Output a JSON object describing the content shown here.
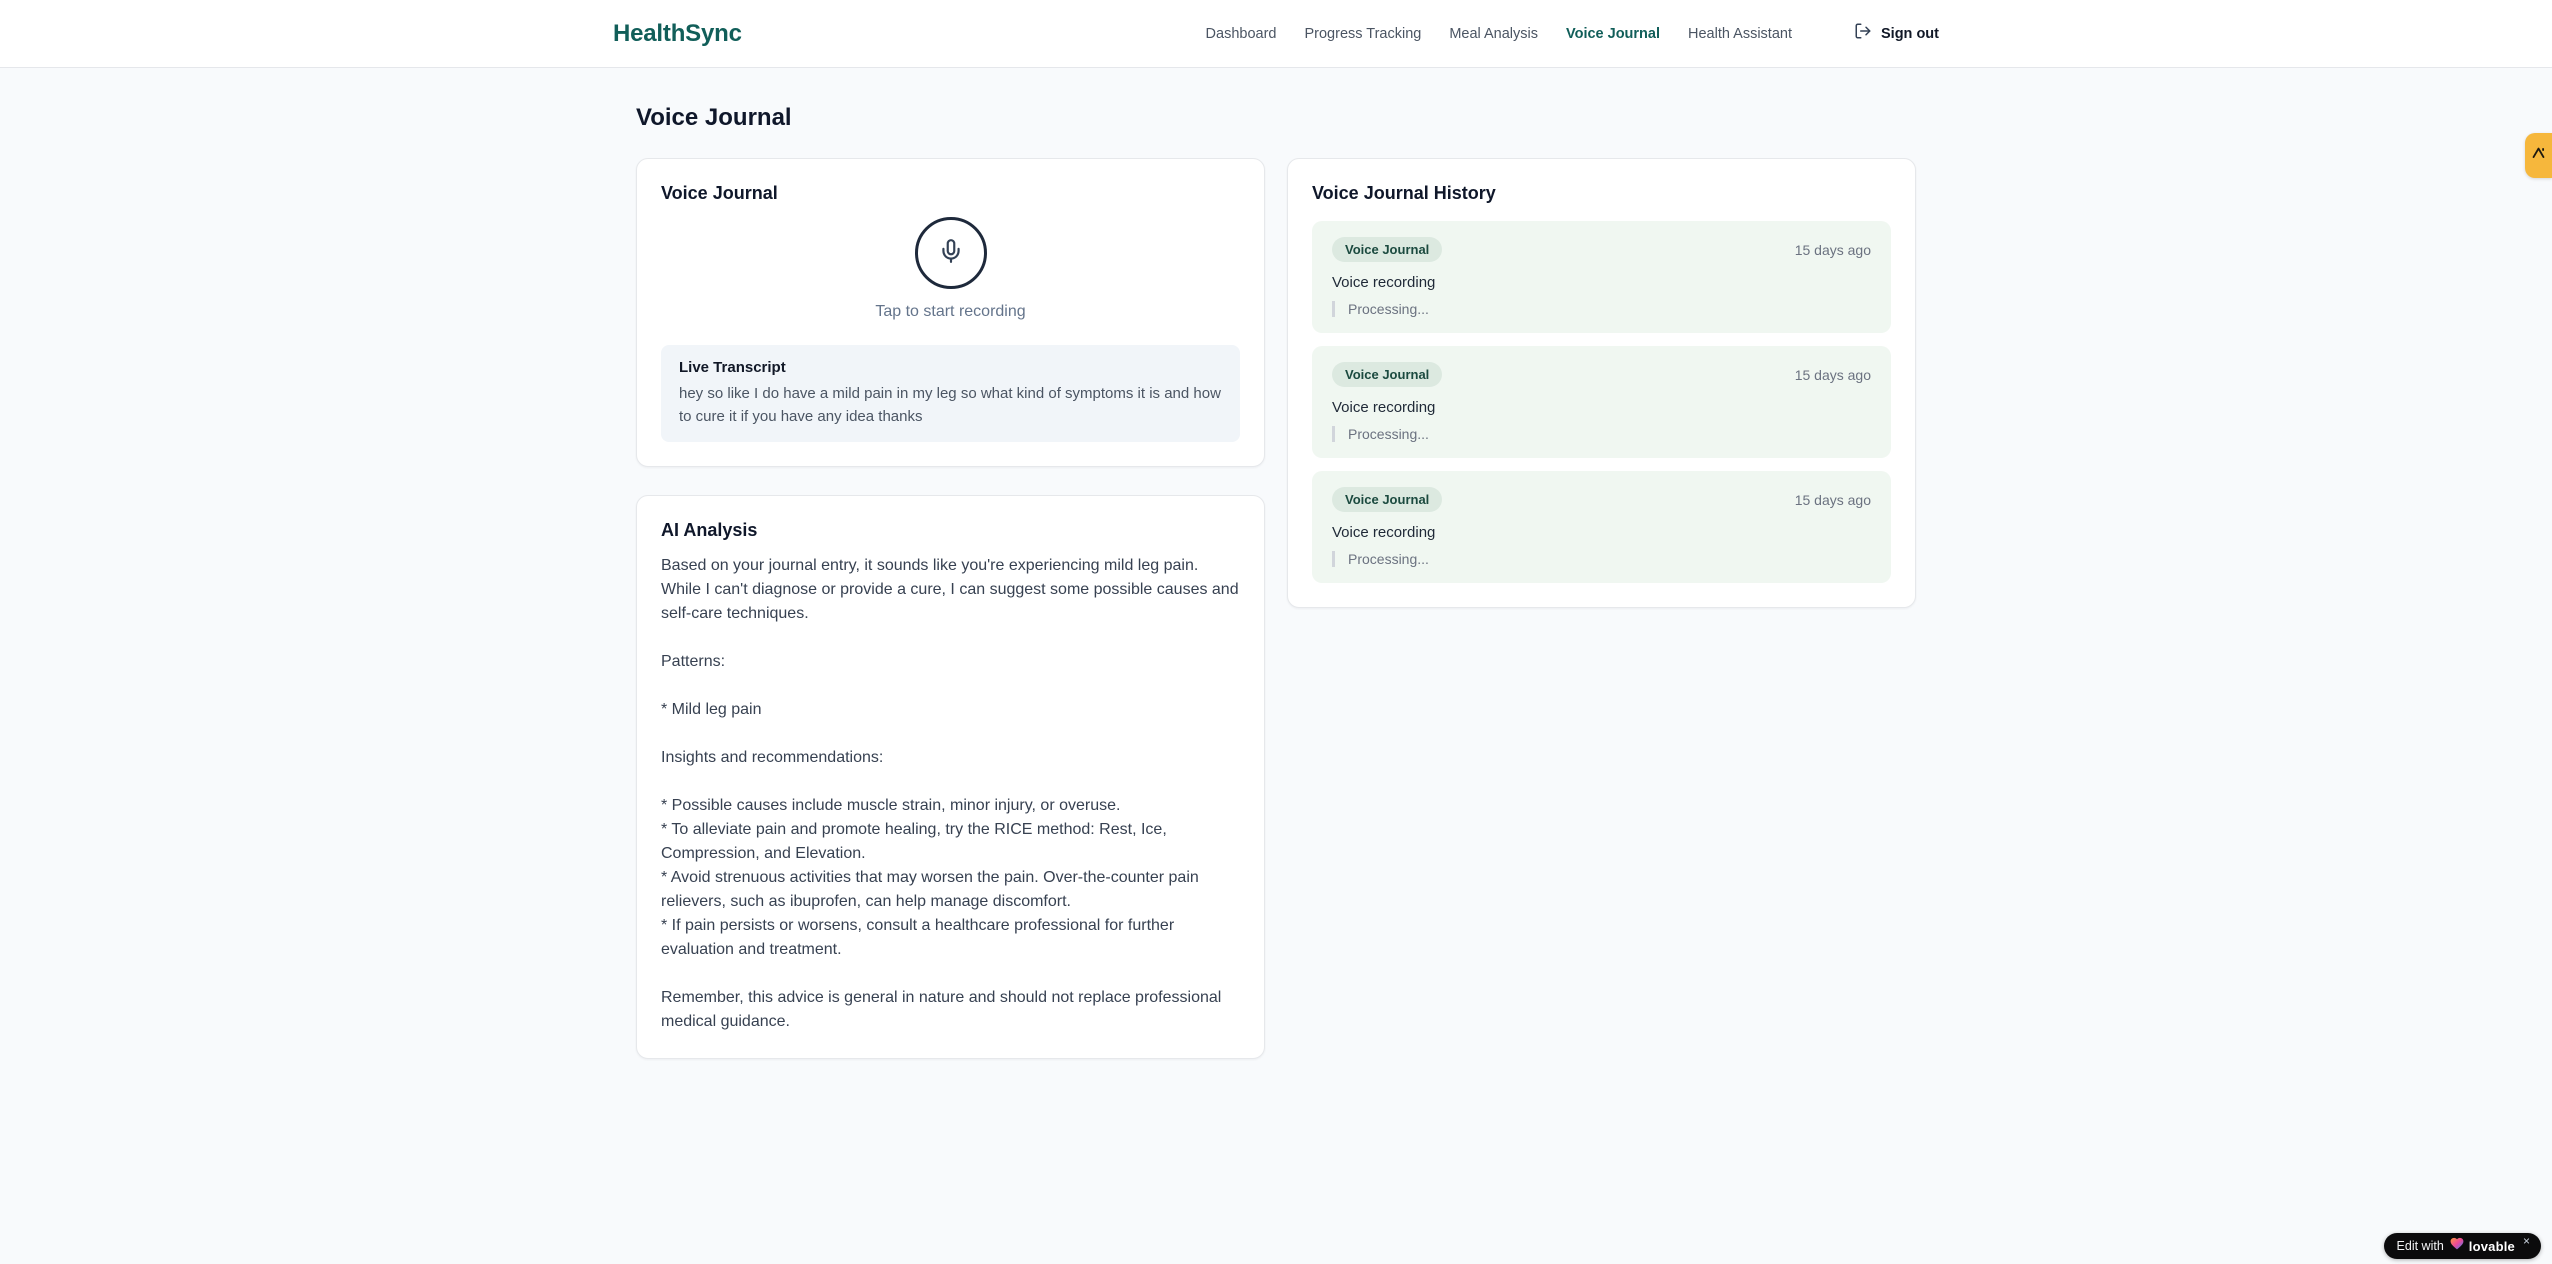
{
  "brand": {
    "name": "HealthSync"
  },
  "nav": {
    "items": [
      {
        "label": "Dashboard",
        "active": false
      },
      {
        "label": "Progress Tracking",
        "active": false
      },
      {
        "label": "Meal Analysis",
        "active": false
      },
      {
        "label": "Voice Journal",
        "active": true
      },
      {
        "label": "Health Assistant",
        "active": false
      }
    ],
    "signout_label": "Sign out"
  },
  "page": {
    "title": "Voice Journal"
  },
  "recorder": {
    "card_title": "Voice Journal",
    "tap_hint": "Tap to start recording",
    "transcript_title": "Live Transcript",
    "transcript_text": "hey so like I do have a mild pain in my leg so what kind of symptoms it is and how to cure it if you have any idea thanks"
  },
  "analysis": {
    "card_title": "AI Analysis",
    "body": "Based on your journal entry, it sounds like you're experiencing mild leg pain. While I can't diagnose or provide a cure, I can suggest some possible causes and self-care techniques.\n\nPatterns:\n\n* Mild leg pain\n\nInsights and recommendations:\n\n* Possible causes include muscle strain, minor injury, or overuse.\n* To alleviate pain and promote healing, try the RICE method: Rest, Ice, Compression, and Elevation.\n* Avoid strenuous activities that may worsen the pain. Over-the-counter pain relievers, such as ibuprofen, can help manage discomfort.\n* If pain persists or worsens, consult a healthcare professional for further evaluation and treatment.\n\nRemember, this advice is general in nature and should not replace professional medical guidance."
  },
  "history": {
    "card_title": "Voice Journal History",
    "entries": [
      {
        "badge": "Voice Journal",
        "time": "15 days ago",
        "title": "Voice recording",
        "status": "Processing..."
      },
      {
        "badge": "Voice Journal",
        "time": "15 days ago",
        "title": "Voice recording",
        "status": "Processing..."
      },
      {
        "badge": "Voice Journal",
        "time": "15 days ago",
        "title": "Voice recording",
        "status": "Processing..."
      }
    ]
  },
  "lovable": {
    "prefix": "Edit with",
    "brand": "lovable",
    "close": "×"
  },
  "colors": {
    "brand_teal": "#115e59",
    "page_bg": "#f8fafc",
    "entry_bg": "#f0f7f1",
    "badge_bg": "#dce9e0",
    "side_tab": "#f6b73c",
    "mic_ring": "#1e293b"
  }
}
